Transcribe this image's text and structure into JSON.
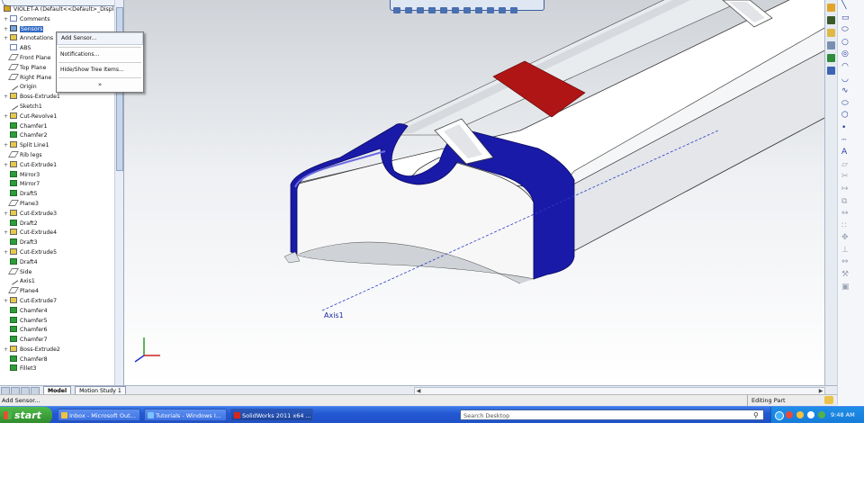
{
  "feature_tree": {
    "root": "VIOLET-A  (Default<<Default>_Display",
    "items": [
      {
        "label": "Comments",
        "icon": "doc-icon",
        "exp": "+"
      },
      {
        "label": "Sensors",
        "icon": "sensor-icon",
        "exp": "+",
        "selected": true
      },
      {
        "label": "Annotations",
        "icon": "annotation-icon",
        "exp": "+"
      },
      {
        "label": "ABS",
        "icon": "material-icon",
        "exp": ""
      },
      {
        "label": "Front Plane",
        "icon": "plane-icon",
        "exp": ""
      },
      {
        "label": "Top Plane",
        "icon": "plane-icon",
        "exp": ""
      },
      {
        "label": "Right Plane",
        "icon": "plane-icon",
        "exp": ""
      },
      {
        "label": "Origin",
        "icon": "origin-icon",
        "exp": ""
      },
      {
        "label": "Boss-Extrude1",
        "icon": "feature-icon",
        "exp": "+"
      },
      {
        "label": "Sketch1",
        "icon": "sketch-icon",
        "exp": ""
      },
      {
        "label": "Cut-Revolve1",
        "icon": "feature-icon",
        "exp": "+"
      },
      {
        "label": "Chamfer1",
        "icon": "chamfer-icon",
        "exp": ""
      },
      {
        "label": "Chamfer2",
        "icon": "chamfer-icon",
        "exp": ""
      },
      {
        "label": "Split Line1",
        "icon": "feature-icon",
        "exp": "+"
      },
      {
        "label": "Rib legs",
        "icon": "plane-icon",
        "exp": ""
      },
      {
        "label": "Cut-Extrude1",
        "icon": "feature-icon",
        "exp": "+"
      },
      {
        "label": "Mirror3",
        "icon": "mirror-icon",
        "exp": ""
      },
      {
        "label": "Mirror7",
        "icon": "mirror-icon",
        "exp": ""
      },
      {
        "label": "Draft5",
        "icon": "draft-icon",
        "exp": ""
      },
      {
        "label": "Plane3",
        "icon": "plane-icon",
        "exp": ""
      },
      {
        "label": "Cut-Extrude3",
        "icon": "feature-icon",
        "exp": "+"
      },
      {
        "label": "Draft2",
        "icon": "draft-icon",
        "exp": ""
      },
      {
        "label": "Cut-Extrude4",
        "icon": "feature-icon",
        "exp": "+"
      },
      {
        "label": "Draft3",
        "icon": "draft-icon",
        "exp": ""
      },
      {
        "label": "Cut-Extrude5",
        "icon": "feature-icon",
        "exp": "+"
      },
      {
        "label": "Draft4",
        "icon": "draft-icon",
        "exp": ""
      },
      {
        "label": "Side",
        "icon": "plane-icon",
        "exp": ""
      },
      {
        "label": "Axis1",
        "icon": "axis-icon",
        "exp": ""
      },
      {
        "label": "Plane4",
        "icon": "plane-icon",
        "exp": ""
      },
      {
        "label": "Cut-Extrude7",
        "icon": "feature-icon",
        "exp": "+"
      },
      {
        "label": "Chamfer4",
        "icon": "chamfer-icon",
        "exp": ""
      },
      {
        "label": "Chamfer5",
        "icon": "chamfer-icon",
        "exp": ""
      },
      {
        "label": "Chamfer6",
        "icon": "chamfer-icon",
        "exp": ""
      },
      {
        "label": "Chamfer7",
        "icon": "chamfer-icon",
        "exp": ""
      },
      {
        "label": "Boss-Extrude2",
        "icon": "feature-icon",
        "exp": "+"
      },
      {
        "label": "Chamfer8",
        "icon": "chamfer-icon",
        "exp": ""
      },
      {
        "label": "Fillet3",
        "icon": "fillet-icon",
        "exp": ""
      }
    ]
  },
  "context_menu": {
    "items": [
      "Add Sensor...",
      "Notifications...",
      "Hide/Show Tree Items..."
    ],
    "more": "»"
  },
  "viewport": {
    "axis_label": "Axis1",
    "colors": {
      "selected_face": "#1a1aa8",
      "red_face": "#b01515",
      "model": "#ffffff"
    }
  },
  "tabs": [
    "Model",
    "Motion Study 1"
  ],
  "status": {
    "message": "Add Sensor...",
    "mode": "Editing Part"
  },
  "taskbar": {
    "start": "start",
    "buttons": [
      {
        "label": "Inbox - Microsoft Out...",
        "icon": "outlook-icon"
      },
      {
        "label": "Tutorials - Windows I...",
        "icon": "ie-icon"
      },
      {
        "label": "SolidWorks 2011 x64 ...",
        "icon": "solidworks-icon"
      }
    ],
    "search_placeholder": "Search Desktop",
    "clock": "9:48 AM"
  },
  "sketch_tools": [
    "line-icon",
    "rectangle-icon",
    "slot-icon",
    "circle-icon",
    "circle-perimeter-icon",
    "arc-icon",
    "arc-3pt-icon",
    "spline-icon",
    "ellipse-icon",
    "polygon-icon",
    "point-icon",
    "centerline-icon",
    "text-icon",
    "plane-icon",
    "trim-icon",
    "extend-icon",
    "offset-icon",
    "mirror-icon",
    "linear-pattern-icon",
    "move-icon",
    "relation-icon",
    "dimension-icon",
    "repair-icon",
    "rapid-sketch-icon"
  ]
}
